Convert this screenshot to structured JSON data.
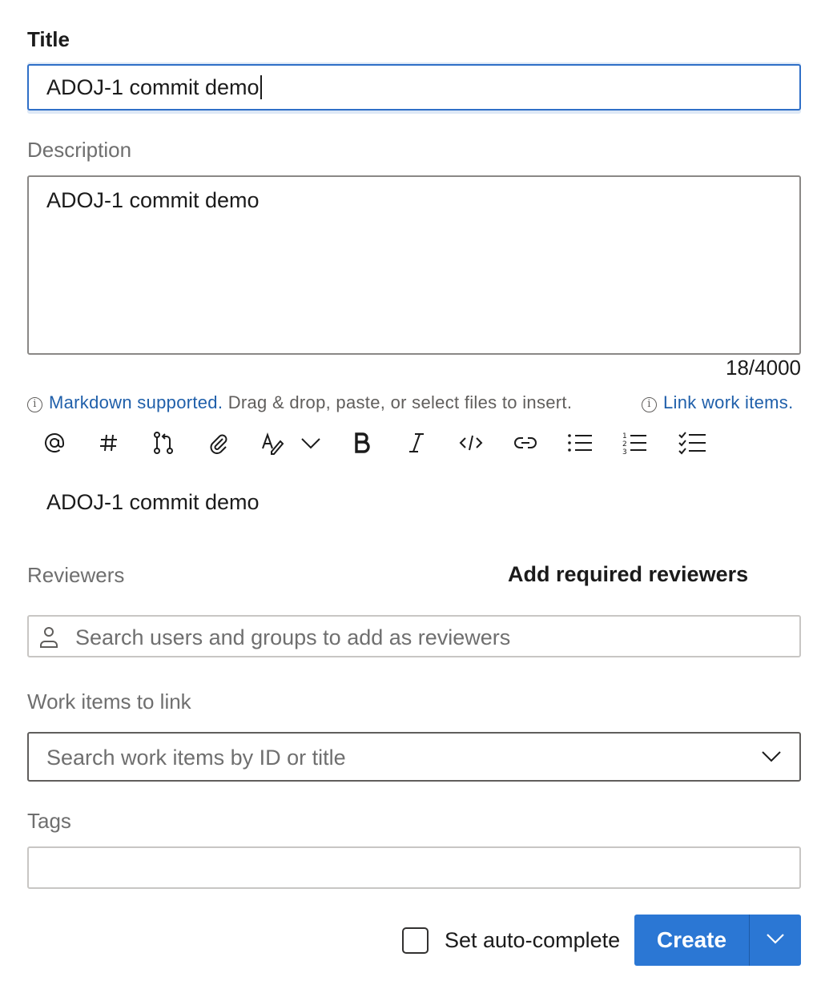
{
  "title": {
    "label": "Title",
    "value": "ADOJ-1 commit demo"
  },
  "description": {
    "label": "Description",
    "value": "ADOJ-1 commit demo",
    "counter": "18/4000"
  },
  "hints": {
    "markdown_link": "Markdown supported.",
    "drag_text": "Drag & drop, paste, or select files to insert.",
    "link_work_items": "Link work items."
  },
  "toolbar": {
    "items": [
      "mention-icon",
      "hash-icon",
      "pull-request-icon",
      "attach-icon",
      "format-text-icon",
      "chevron-down-icon",
      "bold-icon",
      "italic-icon",
      "code-icon",
      "link-icon",
      "bulleted-list-icon",
      "numbered-list-icon",
      "checklist-icon"
    ]
  },
  "preview": {
    "text": "ADOJ-1 commit demo"
  },
  "reviewers": {
    "label": "Reviewers",
    "add_required": "Add required reviewers",
    "placeholder": "Search users and groups to add as reviewers"
  },
  "work_items": {
    "label": "Work items to link",
    "placeholder": "Search work items by ID or title"
  },
  "tags": {
    "label": "Tags"
  },
  "footer": {
    "auto_complete_label": "Set auto-complete",
    "auto_complete_checked": false,
    "create_label": "Create"
  },
  "colors": {
    "accent": "#2b77d4",
    "link": "#1f5faa",
    "focus_border": "#2f6fc7"
  }
}
